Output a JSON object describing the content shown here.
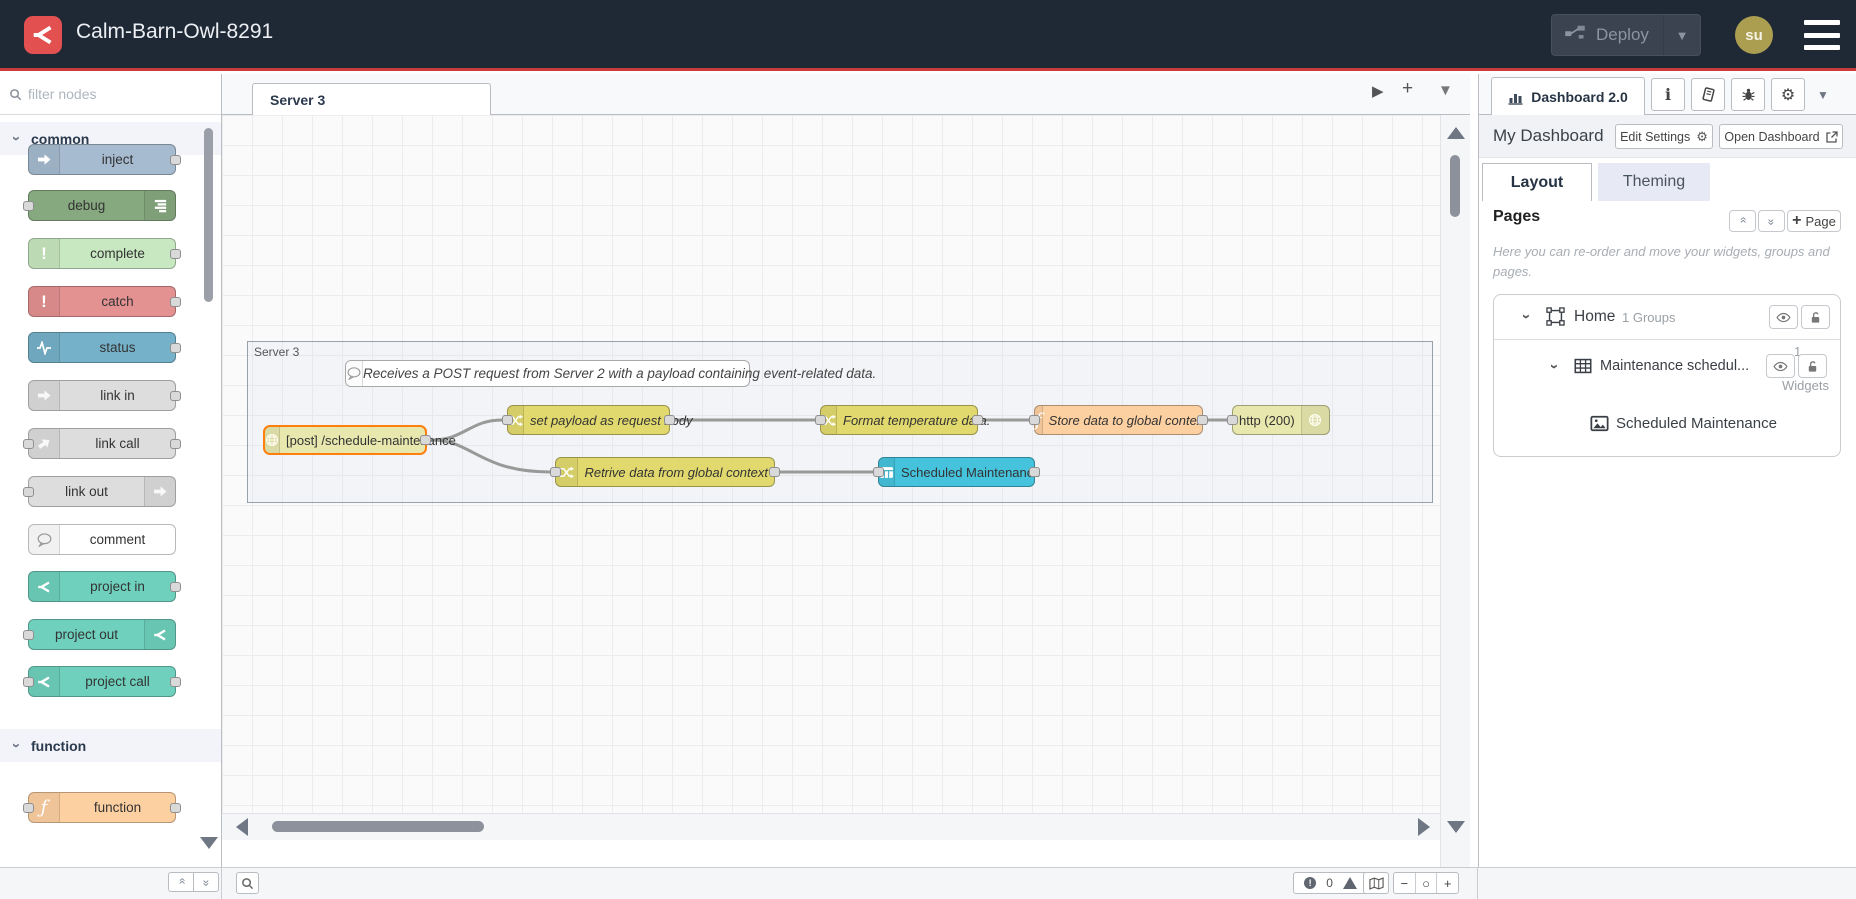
{
  "header": {
    "title": "Calm-Barn-Owl-8291",
    "deploy_label": "Deploy",
    "avatar_initials": "su"
  },
  "palette": {
    "filter_placeholder": "filter nodes",
    "sections": [
      {
        "label": "common",
        "items": [
          {
            "label": "inject"
          },
          {
            "label": "debug"
          },
          {
            "label": "complete"
          },
          {
            "label": "catch"
          },
          {
            "label": "status"
          },
          {
            "label": "link in"
          },
          {
            "label": "link call"
          },
          {
            "label": "link out"
          },
          {
            "label": "comment"
          },
          {
            "label": "project in"
          },
          {
            "label": "project out"
          },
          {
            "label": "project call"
          }
        ]
      },
      {
        "label": "function",
        "items": [
          {
            "label": "function"
          }
        ]
      }
    ]
  },
  "workspace": {
    "tab_label": "Server 3",
    "group_label": "Server 3",
    "comment_text": "Receives a POST request from Server 2 with a payload containing event-related data.",
    "nodes": {
      "http_in": {
        "label": "[post] /schedule-maintenance"
      },
      "set_payload": {
        "label": "set payload as request body"
      },
      "format_temp": {
        "label": "Format temperature data."
      },
      "store_data": {
        "label": "Store data to global context"
      },
      "http_response": {
        "label": "http (200)"
      },
      "retrieve_data": {
        "label": "Retrive data from global context"
      },
      "table_widget": {
        "label": "Scheduled Maintenance"
      }
    },
    "status": {
      "errors": "0",
      "warnings": "0"
    }
  },
  "sidebar": {
    "tab_label": "Dashboard 2.0",
    "dashboard_name": "My Dashboard",
    "edit_settings_label": "Edit Settings",
    "open_dashboard_label": "Open Dashboard",
    "tabs": {
      "layout": "Layout",
      "theming": "Theming"
    },
    "pages": {
      "title": "Pages",
      "add_page_label": "Page",
      "hint": "Here you can re-order and move your widgets, groups and pages."
    },
    "tree": {
      "page": {
        "label": "Home",
        "meta": "1 Groups"
      },
      "group": {
        "label": "Maintenance schedul...",
        "meta_count": "1",
        "meta_unit": "Widgets"
      },
      "widget": {
        "label": "Scheduled Maintenance"
      }
    }
  },
  "colors": {
    "header_bg": "#1f2936",
    "accent_red": "#c93a3a",
    "logo_red": "#e25050",
    "selection_orange": "#ff7f0e",
    "node_inject": "#a6bbcf",
    "node_debug": "#87a980",
    "node_complete": "#c7e8c0",
    "node_catch": "#e49191",
    "node_status": "#75b1c9",
    "node_link": "#dddddd",
    "node_project": "#6fd1bd",
    "node_function": "#fdd0a2",
    "node_change": "#e2d96e",
    "node_http": "#e7e7ae",
    "node_table": "#45c3dc"
  }
}
